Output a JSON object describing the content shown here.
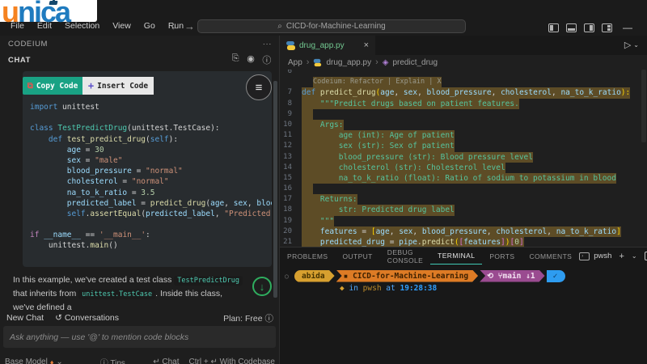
{
  "icons": {
    "search": "⌕",
    "back": "←",
    "forward": "→",
    "minimize": "—",
    "more": "···",
    "close": "×",
    "run": "▷",
    "caret": "⌄",
    "chevron": "›",
    "plus": "+",
    "history": "↺",
    "info": "ⓘ",
    "enter": "↵",
    "diamond": "◆",
    "gem": "♦",
    "check": "✓",
    "branch": "⑂",
    "sync": "⟲",
    "folder": "▪",
    "circle": "○",
    "hamburger": "≡",
    "down_arrow": "↓",
    "export": "⎘",
    "account": "◉",
    "clipboard": "⧉",
    "method": "◈",
    "trash": "🗑"
  },
  "titlebar": {
    "menus": [
      "File",
      "Edit",
      "Selection",
      "View",
      "Go",
      "Run",
      "···"
    ],
    "search": "CICD-for-Machine-Learning"
  },
  "brand": {
    "u": "u",
    "rest": "nica"
  },
  "sidebar": {
    "title": "CODEIUM",
    "section": "CHAT",
    "more": "···",
    "buttons": {
      "copy": "Copy Code",
      "insert": "Insert Code"
    },
    "code_lines": [
      [
        [
          "import",
          "kw"
        ],
        [
          " unittest",
          "pl"
        ]
      ],
      [],
      [
        [
          "class",
          "kw"
        ],
        [
          " ",
          "pl"
        ],
        [
          "TestPredictDrug",
          "cl"
        ],
        [
          "(unittest.TestCase):",
          "pl"
        ]
      ],
      [
        [
          "    ",
          "pl"
        ],
        [
          "def",
          "kw"
        ],
        [
          " ",
          "pl"
        ],
        [
          "test_predict_drug",
          "fn"
        ],
        [
          "(",
          "pl"
        ],
        [
          "self",
          "kw"
        ],
        [
          "):",
          "pl"
        ]
      ],
      [
        [
          "        ",
          "pl"
        ],
        [
          "age",
          "vr"
        ],
        [
          " = ",
          "pl"
        ],
        [
          "30",
          "nm"
        ]
      ],
      [
        [
          "        ",
          "pl"
        ],
        [
          "sex",
          "vr"
        ],
        [
          " = ",
          "pl"
        ],
        [
          "\"male\"",
          "st"
        ]
      ],
      [
        [
          "        ",
          "pl"
        ],
        [
          "blood_pressure",
          "vr"
        ],
        [
          " = ",
          "pl"
        ],
        [
          "\"normal\"",
          "st"
        ]
      ],
      [
        [
          "        ",
          "pl"
        ],
        [
          "cholesterol",
          "vr"
        ],
        [
          " = ",
          "pl"
        ],
        [
          "\"normal\"",
          "st"
        ]
      ],
      [
        [
          "        ",
          "pl"
        ],
        [
          "na_to_k_ratio",
          "vr"
        ],
        [
          " = ",
          "pl"
        ],
        [
          "3.5",
          "nm"
        ]
      ],
      [
        [
          "        ",
          "pl"
        ],
        [
          "predicted_label",
          "vr"
        ],
        [
          " = ",
          "pl"
        ],
        [
          "predict_drug",
          "fn"
        ],
        [
          "(",
          "pl"
        ],
        [
          "age",
          "vr"
        ],
        [
          ", ",
          "pl"
        ],
        [
          "sex",
          "vr"
        ],
        [
          ", ",
          "pl"
        ],
        [
          "blood_p",
          "vr"
        ]
      ],
      [
        [
          "        ",
          "pl"
        ],
        [
          "self",
          "kw"
        ],
        [
          ".",
          "pl"
        ],
        [
          "assertEqual",
          "fn"
        ],
        [
          "(",
          "pl"
        ],
        [
          "predicted_label",
          "vr"
        ],
        [
          ", ",
          "pl"
        ],
        [
          "\"Predicted Dru",
          "st"
        ]
      ],
      [],
      [
        [
          "if",
          "ct"
        ],
        [
          " ",
          "pl"
        ],
        [
          "__name__",
          "vr"
        ],
        [
          " == ",
          "pl"
        ],
        [
          "'__main__'",
          "st"
        ],
        [
          ":",
          "pl"
        ]
      ],
      [
        [
          "    unittest.",
          "pl"
        ],
        [
          "main",
          "fn"
        ],
        [
          "()",
          "pl"
        ]
      ]
    ],
    "explanation": {
      "p1": "In this example, we've created a test class ",
      "code1": "TestPredictDrug",
      "p2": " that inherits from ",
      "code2": "unittest.TestCase",
      "p3": ". Inside this class, we've defined a"
    },
    "footer": {
      "new_chat": "New Chat",
      "conversations": "Conversations",
      "plan": "Plan: Free",
      "input_placeholder": "Ask anything — use '@' to mention code blocks",
      "model": "Base Model",
      "tips": "Tips",
      "chat": "Chat",
      "with_codebase": "Ctrl + ↵ With Codebase"
    }
  },
  "editor": {
    "tab_label": "drug_app.py",
    "breadcrumbs": [
      "App",
      "drug_app.py",
      "predict_drug"
    ],
    "lines": [
      {
        "n": "6",
        "tok": []
      },
      {
        "lens": "Codeium: Refactor | Explain | X"
      },
      {
        "n": "7",
        "sel": true,
        "tok": [
          [
            "def",
            "kw"
          ],
          [
            " ",
            "pl"
          ],
          [
            "predict_drug",
            "fn"
          ],
          [
            "(",
            "b1"
          ],
          [
            "age",
            "vr"
          ],
          [
            ", ",
            "pl"
          ],
          [
            "sex",
            "vr"
          ],
          [
            ", ",
            "pl"
          ],
          [
            "blood_pressure",
            "vr"
          ],
          [
            ", ",
            "pl"
          ],
          [
            "cholesterol",
            "vr"
          ],
          [
            ", ",
            "pl"
          ],
          [
            "na_to_k_ratio",
            "vr"
          ],
          [
            "):",
            "b1"
          ]
        ]
      },
      {
        "n": "8",
        "sel": true,
        "tok": [
          [
            "    ",
            "pl"
          ],
          [
            "\"\"\"Predict drugs based on patient features.",
            "dc"
          ]
        ]
      },
      {
        "n": "9",
        "sel": true,
        "tok": []
      },
      {
        "n": "10",
        "sel": true,
        "tok": [
          [
            "    ",
            "pl"
          ],
          [
            "Args:",
            "dc"
          ]
        ]
      },
      {
        "n": "11",
        "sel": true,
        "tok": [
          [
            "        ",
            "pl"
          ],
          [
            "age (int): Age of patient",
            "dc"
          ]
        ]
      },
      {
        "n": "12",
        "sel": true,
        "tok": [
          [
            "        ",
            "pl"
          ],
          [
            "sex (str): Sex of patient",
            "dc"
          ]
        ]
      },
      {
        "n": "13",
        "sel": true,
        "tok": [
          [
            "        ",
            "pl"
          ],
          [
            "blood_pressure (str): Blood pressure level",
            "dc"
          ]
        ]
      },
      {
        "n": "14",
        "sel": true,
        "tok": [
          [
            "        ",
            "pl"
          ],
          [
            "cholesterol (str): Cholesterol level",
            "dc"
          ]
        ]
      },
      {
        "n": "15",
        "sel": true,
        "tok": [
          [
            "        ",
            "pl"
          ],
          [
            "na_to_k_ratio (float): Ratio of sodium to potassium in blood",
            "dc"
          ]
        ]
      },
      {
        "n": "16",
        "sel": true,
        "tok": []
      },
      {
        "n": "17",
        "sel": true,
        "tok": [
          [
            "    ",
            "pl"
          ],
          [
            "Returns:",
            "dc"
          ]
        ]
      },
      {
        "n": "18",
        "sel": true,
        "tok": [
          [
            "        ",
            "pl"
          ],
          [
            "str: Predicted drug label",
            "dc"
          ]
        ]
      },
      {
        "n": "19",
        "sel": true,
        "tok": [
          [
            "    ",
            "pl"
          ],
          [
            "\"\"\"",
            "dc"
          ]
        ]
      },
      {
        "n": "20",
        "sel": true,
        "tok": [
          [
            "    ",
            "pl"
          ],
          [
            "features",
            "vr"
          ],
          [
            " = ",
            "pl"
          ],
          [
            "[",
            "b1"
          ],
          [
            "age",
            "vr"
          ],
          [
            ", ",
            "pl"
          ],
          [
            "sex",
            "vr"
          ],
          [
            ", ",
            "pl"
          ],
          [
            "blood_pressure",
            "vr"
          ],
          [
            ", ",
            "pl"
          ],
          [
            "cholesterol",
            "vr"
          ],
          [
            ", ",
            "pl"
          ],
          [
            "na_to_k_ratio",
            "vr"
          ],
          [
            "]",
            "b1"
          ]
        ]
      },
      {
        "n": "21",
        "sel": true,
        "tok": [
          [
            "    ",
            "pl"
          ],
          [
            "predicted_drug",
            "vr"
          ],
          [
            " = ",
            "pl"
          ],
          [
            "pipe",
            "vr"
          ],
          [
            ".",
            "pl"
          ],
          [
            "predict",
            "fn"
          ],
          [
            "(",
            "b1"
          ],
          [
            "[",
            "b2"
          ],
          [
            "features",
            "vr"
          ],
          [
            "]",
            "b2"
          ],
          [
            ")",
            "b1"
          ],
          [
            "[",
            "b2"
          ],
          [
            "0",
            "nm"
          ],
          [
            "]",
            "b2"
          ]
        ]
      }
    ]
  },
  "panel": {
    "tabs": [
      "PROBLEMS",
      "OUTPUT",
      "DEBUG CONSOLE",
      "TERMINAL",
      "PORTS",
      "COMMENTS"
    ],
    "shell_label": "pwsh",
    "prompt": {
      "user": "abida",
      "repo": "CICD-for-Machine-Learning",
      "branch": "main",
      "behind": "↓1",
      "line2_in": "in",
      "line2_shell": "pwsh",
      "line2_at": "at",
      "line2_time": "19:28:38"
    }
  }
}
